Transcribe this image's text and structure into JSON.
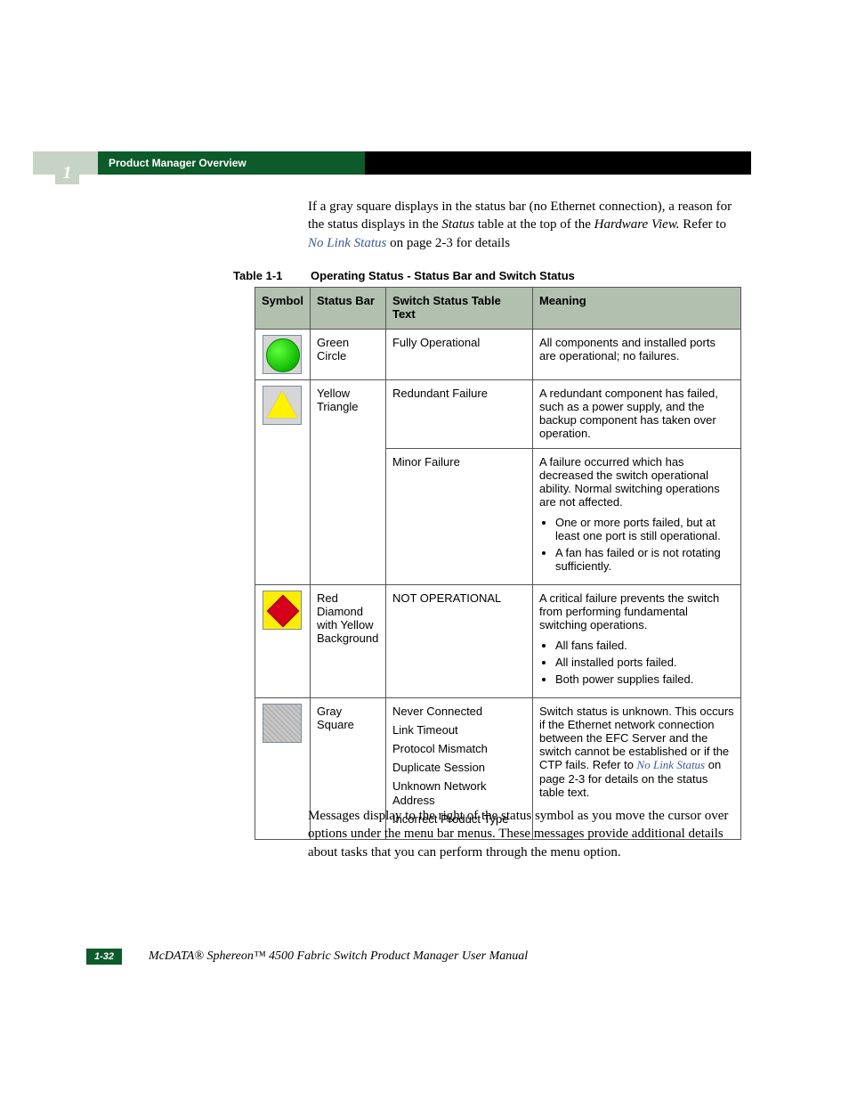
{
  "header": {
    "section_title": "Product Manager Overview",
    "chapter_number": "1"
  },
  "intro": {
    "pre": "If a gray square displays in the status bar (no Ethernet connection), a reason for the status displays in the ",
    "em1": "Status",
    "mid": " table at the top of the ",
    "em2": "Hardware View.",
    "post1": " Refer to ",
    "link": "No Link Status",
    "post2": " on page 2-3 for details"
  },
  "table_caption": {
    "num": "Table 1-1",
    "title": "Operating Status - Status Bar and Switch Status"
  },
  "table": {
    "headers": {
      "symbol": "Symbol",
      "status_bar": "Status Bar",
      "switch_text": "Switch Status Table Text",
      "meaning": "Meaning"
    },
    "rows": {
      "green": {
        "status_bar": "Green Circle",
        "switch_text": "Fully Operational",
        "meaning": "All components and installed ports are operational; no failures."
      },
      "yellow1": {
        "status_bar": "Yellow Triangle",
        "switch_text": "Redundant Failure",
        "meaning": "A redundant component has failed, such as a power supply, and the backup component has taken over operation."
      },
      "yellow2": {
        "switch_text": "Minor Failure",
        "meaning_intro": "A failure occurred which has decreased the switch operational ability. Normal switching operations are not affected.",
        "bullets": [
          "One or more ports failed, but at least one port is still operational.",
          "A fan has failed or is not rotating sufficiently."
        ]
      },
      "red": {
        "status_bar": "Red Diamond with Yellow Background",
        "switch_text": "NOT OPERATIONAL",
        "meaning_intro": "A critical failure prevents the switch from performing fundamental switching operations.",
        "bullets": [
          "All fans failed.",
          "All installed ports failed.",
          "Both power supplies failed."
        ]
      },
      "gray": {
        "status_bar": "Gray Square",
        "switch_lines": [
          "Never Connected",
          "Link Timeout",
          "Protocol Mismatch",
          "Duplicate Session",
          "Unknown Network Address",
          "Incorrect Product Type"
        ],
        "meaning_pre": "Switch status is unknown. This occurs if the Ethernet network connection between the EFC Server and the switch cannot be established or if the CTP fails. Refer to ",
        "meaning_link": "No Link Status",
        "meaning_post": " on page 2-3 for details on the status table text."
      }
    }
  },
  "outro": "Messages display to the right of the status symbol as you move the cursor over options under the menu bar menus. These messages provide additional details about tasks that you can perform through the menu option.",
  "footer": {
    "page": "1-32",
    "title": "McDATA® Sphereon™ 4500 Fabric Switch Product Manager User Manual"
  }
}
